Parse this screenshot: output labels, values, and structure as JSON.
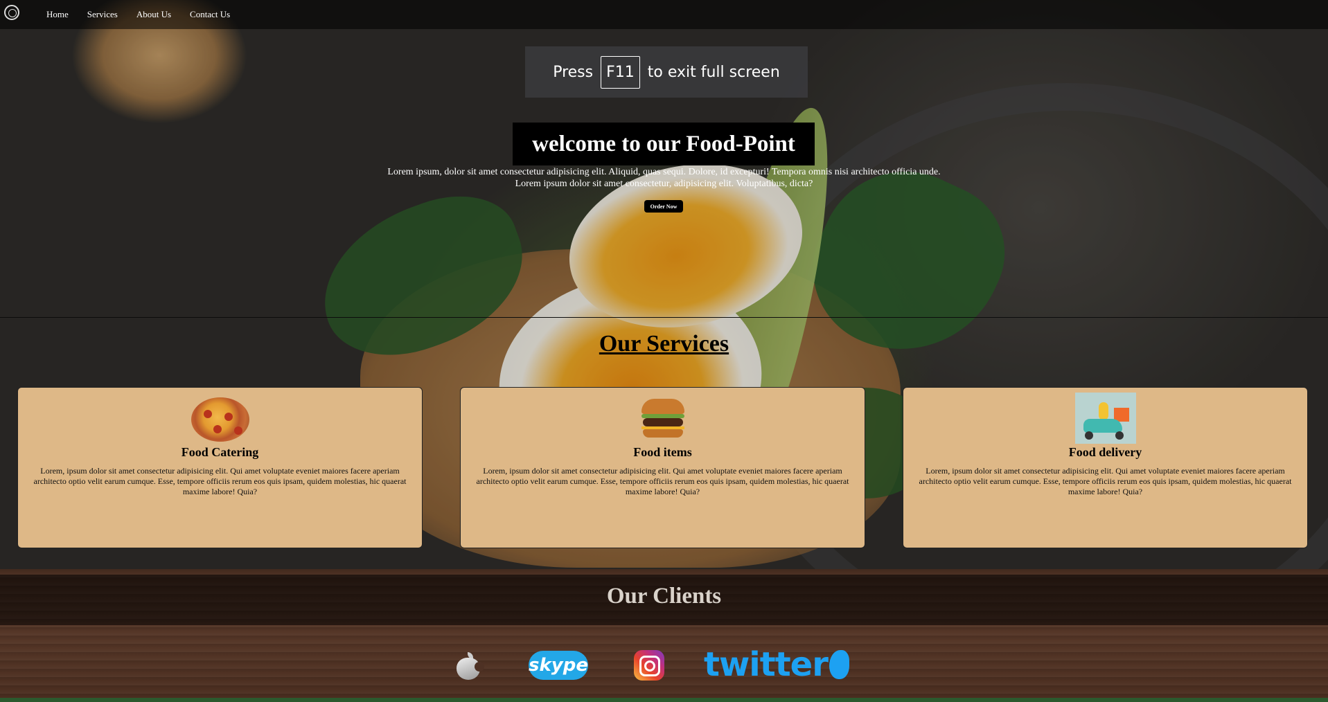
{
  "nav": {
    "logo_icon": "circle-logo-icon",
    "items": [
      "Home",
      "Services",
      "About Us",
      "Contact Us"
    ]
  },
  "fullscreen_notice": {
    "before": "Press",
    "key": "F11",
    "after": "to exit full screen"
  },
  "hero": {
    "title": "welcome to our Food-Point",
    "text_line1": "Lorem ipsum, dolor sit amet consectetur adipisicing elit. Aliquid, quas sequi. Dolore, id excepturi! Tempora omnis nisi architecto officia unde.",
    "text_line2": "Lorem ipsum dolor sit amet consectetur, adipisicing elit. Voluptatibus, dicta?",
    "order_button": "Order Now"
  },
  "services": {
    "title": "Our Services",
    "cards": [
      {
        "title": "Food Catering",
        "icon": "pizza-icon",
        "text": "Lorem, ipsum dolor sit amet consectetur adipisicing elit. Qui amet voluptate eveniet maiores facere aperiam architecto optio velit earum cumque. Esse, tempore officiis rerum eos quis ipsam, quidem molestias, hic quaerat maxime labore! Quia?"
      },
      {
        "title": "Food items",
        "icon": "burger-icon",
        "text": "Lorem, ipsum dolor sit amet consectetur adipisicing elit. Qui amet voluptate eveniet maiores facere aperiam architecto optio velit earum cumque. Esse, tempore officiis rerum eos quis ipsam, quidem molestias, hic quaerat maxime labore! Quia?"
      },
      {
        "title": "Food delivery",
        "icon": "delivery-scooter-icon",
        "text": "Lorem, ipsum dolor sit amet consectetur adipisicing elit. Qui amet voluptate eveniet maiores facere aperiam architecto optio velit earum cumque. Esse, tempore officiis rerum eos quis ipsam, quidem molestias, hic quaerat maxime labore! Quia?"
      }
    ],
    "card_color": "#deb887"
  },
  "clients": {
    "title": "Our Clients",
    "logos": [
      "apple-logo-icon",
      "skype-logo-icon",
      "instagram-logo-icon",
      "twitter-logo-icon"
    ],
    "skype_text": "skype",
    "twitter_text": "twitter"
  }
}
